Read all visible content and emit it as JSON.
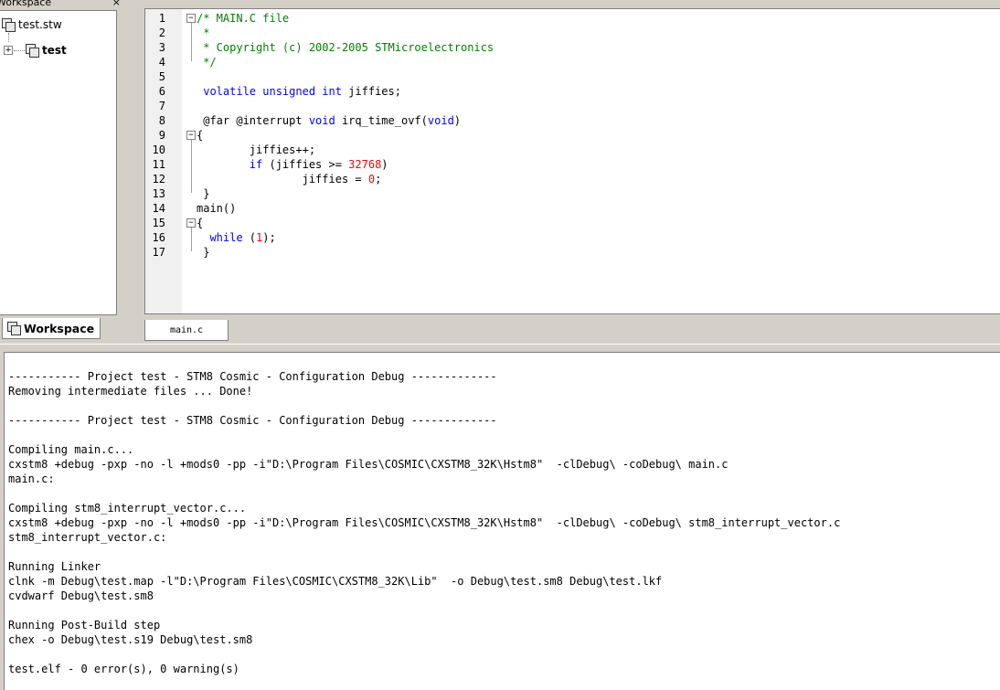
{
  "workspace": {
    "title": "Workspace",
    "close_glyph": "×",
    "tree": {
      "root_label": "test.stw",
      "project_label": "test",
      "expander_glyph": "+"
    },
    "tab_label": "Workspace"
  },
  "editor": {
    "tab_label": "main.c",
    "lines": [
      {
        "n": "1",
        "parts": [
          {
            "c": "cm",
            "t": "/* MAIN.C file"
          }
        ]
      },
      {
        "n": "2",
        "parts": [
          {
            "c": "cm",
            "t": " *"
          }
        ]
      },
      {
        "n": "3",
        "parts": [
          {
            "c": "cm",
            "t": " * Copyright (c) 2002-2005 STMicroelectronics"
          }
        ]
      },
      {
        "n": "4",
        "parts": [
          {
            "c": "cm",
            "t": " */"
          }
        ]
      },
      {
        "n": "5",
        "parts": []
      },
      {
        "n": "6",
        "parts": [
          {
            "c": "",
            "t": " "
          },
          {
            "c": "kw",
            "t": "volatile unsigned int"
          },
          {
            "c": "",
            "t": " jiffies;"
          }
        ]
      },
      {
        "n": "7",
        "parts": []
      },
      {
        "n": "8",
        "parts": [
          {
            "c": "",
            "t": " @far @interrupt "
          },
          {
            "c": "kw",
            "t": "void"
          },
          {
            "c": "",
            "t": " irq_time_ovf("
          },
          {
            "c": "kw",
            "t": "void"
          },
          {
            "c": "",
            "t": ")"
          }
        ]
      },
      {
        "n": "9",
        "parts": [
          {
            "c": "",
            "t": "{"
          }
        ]
      },
      {
        "n": "10",
        "parts": [
          {
            "c": "",
            "t": "        jiffies++;"
          }
        ]
      },
      {
        "n": "11",
        "parts": [
          {
            "c": "",
            "t": "        "
          },
          {
            "c": "kw",
            "t": "if"
          },
          {
            "c": "",
            "t": " (jiffies >= "
          },
          {
            "c": "num",
            "t": "32768"
          },
          {
            "c": "",
            "t": ")"
          }
        ]
      },
      {
        "n": "12",
        "parts": [
          {
            "c": "",
            "t": "                jiffies = "
          },
          {
            "c": "num",
            "t": "0"
          },
          {
            "c": "",
            "t": ";"
          }
        ]
      },
      {
        "n": "13",
        "parts": [
          {
            "c": "",
            "t": " }"
          }
        ]
      },
      {
        "n": "14",
        "parts": [
          {
            "c": "",
            "t": "main()"
          }
        ]
      },
      {
        "n": "15",
        "parts": [
          {
            "c": "",
            "t": "{"
          }
        ]
      },
      {
        "n": "16",
        "parts": [
          {
            "c": "",
            "t": "  "
          },
          {
            "c": "kw",
            "t": "while"
          },
          {
            "c": "",
            "t": " ("
          },
          {
            "c": "num",
            "t": "1"
          },
          {
            "c": "",
            "t": ");"
          }
        ]
      },
      {
        "n": "17",
        "parts": [
          {
            "c": "",
            "t": " }"
          }
        ]
      }
    ]
  },
  "output": {
    "lines": [
      "",
      "----------- Project test - STM8 Cosmic - Configuration Debug -------------",
      "Removing intermediate files ... Done!",
      "",
      "----------- Project test - STM8 Cosmic - Configuration Debug -------------",
      "",
      "Compiling main.c...",
      "cxstm8 +debug -pxp -no -l +mods0 -pp -i\"D:\\Program Files\\COSMIC\\CXSTM8_32K\\Hstm8\"  -clDebug\\ -coDebug\\ main.c",
      "main.c:",
      "",
      "Compiling stm8_interrupt_vector.c...",
      "cxstm8 +debug -pxp -no -l +mods0 -pp -i\"D:\\Program Files\\COSMIC\\CXSTM8_32K\\Hstm8\"  -clDebug\\ -coDebug\\ stm8_interrupt_vector.c",
      "stm8_interrupt_vector.c:",
      "",
      "Running Linker",
      "clnk -m Debug\\test.map -l\"D:\\Program Files\\COSMIC\\CXSTM8_32K\\Lib\"  -o Debug\\test.sm8 Debug\\test.lkf",
      "cvdwarf Debug\\test.sm8",
      "",
      "Running Post-Build step",
      "chex -o Debug\\test.s19 Debug\\test.sm8",
      "",
      "test.elf - 0 error(s), 0 warning(s)"
    ]
  }
}
